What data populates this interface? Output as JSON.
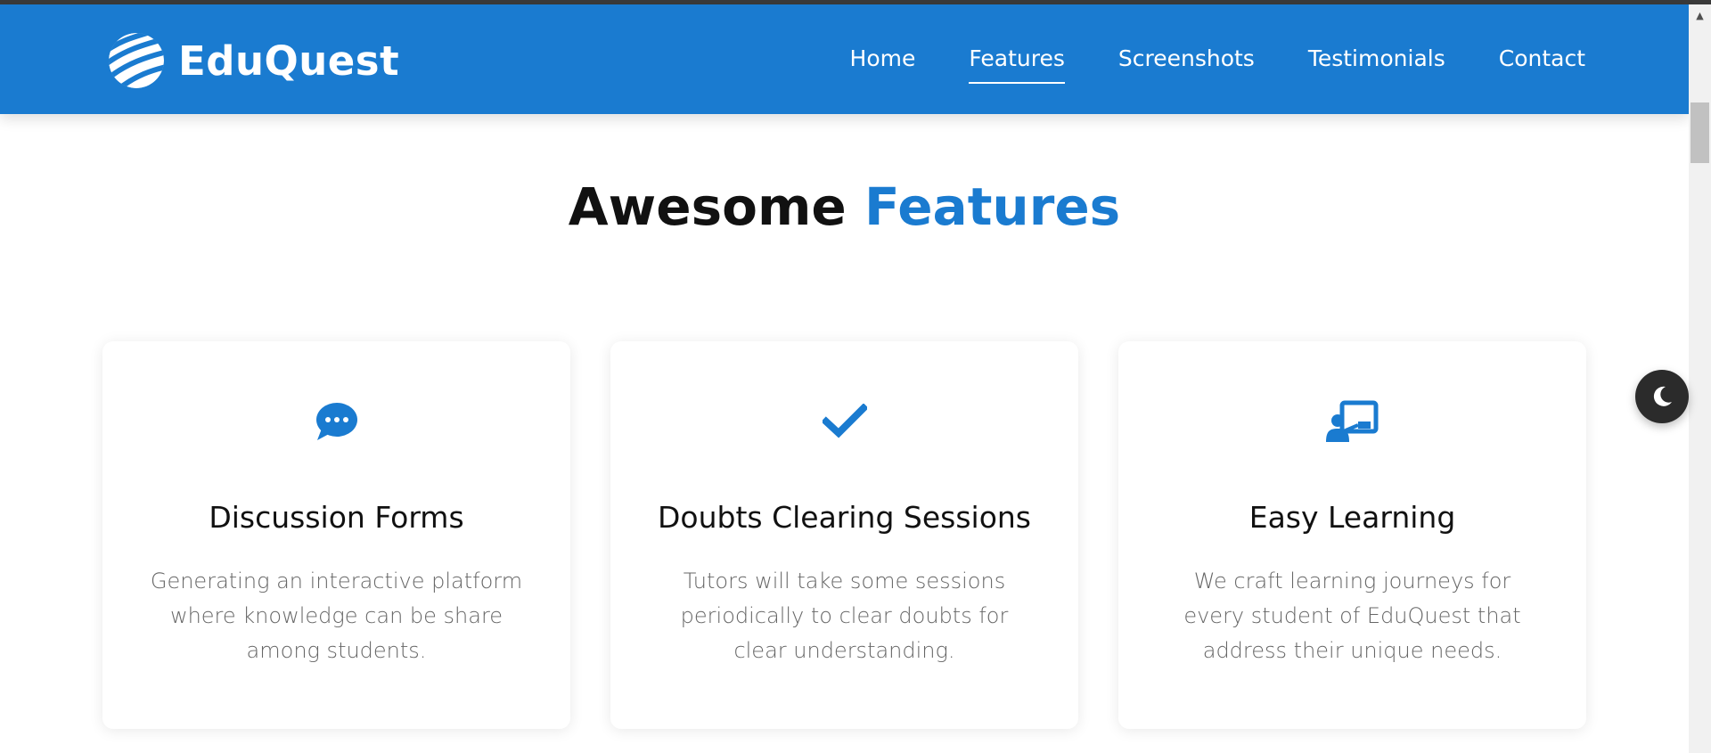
{
  "brand": {
    "name": "EduQuest",
    "logo_icon": "striped-globe-icon"
  },
  "nav": {
    "items": [
      {
        "label": "Home",
        "active": false
      },
      {
        "label": "Features",
        "active": true
      },
      {
        "label": "Screenshots",
        "active": false
      },
      {
        "label": "Testimonials",
        "active": false
      },
      {
        "label": "Contact",
        "active": false
      }
    ]
  },
  "section": {
    "title_prefix": "Awesome",
    "title_accent": "Features"
  },
  "features": [
    {
      "icon": "chat-bubble-icon",
      "title": "Discussion Forms",
      "text": "Generating an interactive platform where knowledge can be share among students."
    },
    {
      "icon": "checkmark-icon",
      "title": "Doubts Clearing Sessions",
      "text": "Tutors will take some sessions periodically to clear doubts for clear understanding."
    },
    {
      "icon": "chalkboard-teacher-icon",
      "title": "Easy Learning",
      "text": "We craft learning journeys for every student of EduQuest that address their unique needs."
    }
  ],
  "theme_toggle": {
    "icon": "moon-icon"
  },
  "colors": {
    "primary": "#1a7bd0",
    "heading": "#111111",
    "body_text": "#666666",
    "toggle_bg": "#2b2b2b"
  }
}
